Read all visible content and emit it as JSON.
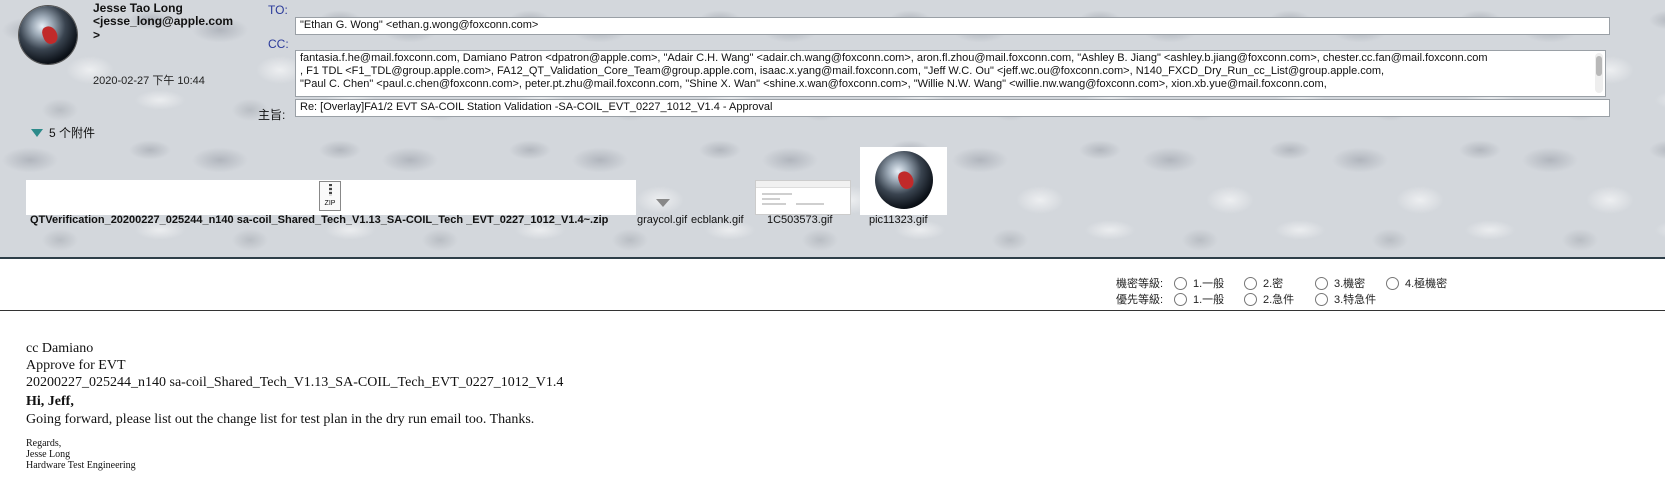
{
  "sender": {
    "name": "Jesse Tao Long",
    "email": "<jesse_long@apple.com",
    "email_end": ">",
    "date": "2020-02-27 下午 10:44"
  },
  "labels": {
    "to": "TO:",
    "cc": "CC:",
    "subject": "主旨:"
  },
  "to": "\"Ethan G. Wong\" <ethan.g.wong@foxconn.com>",
  "cc": [
    "fantasia.f.he@mail.foxconn.com, Damiano Patron <dpatron@apple.com>, \"Adair C.H. Wang\" <adair.ch.wang@foxconn.com>, aron.fl.zhou@mail.foxconn.com, \"Ashley B. Jiang\" <ashley.b.jiang@foxconn.com>, chester.cc.fan@mail.foxconn.com",
    ", F1 TDL <F1_TDL@group.apple.com>, FA12_QT_Validation_Core_Team@group.apple.com, isaac.x.yang@mail.foxconn.com, \"Jeff W.C. Ou\" <jeff.wc.ou@foxconn.com>, N140_FXCD_Dry_Run_cc_List@group.apple.com,",
    "\"Paul C. Chen\" <paul.c.chen@foxconn.com>, peter.pt.zhu@mail.foxconn.com, \"Shine X. Wan\" <shine.x.wan@foxconn.com>, \"Willie N.W. Wang\" <willie.nw.wang@foxconn.com>, xion.xb.yue@mail.foxconn.com,"
  ],
  "subject": "Re: [Overlay]FA1/2 EVT SA-COIL Station Validation -SA-COIL_EVT_0227_1012_V1.4 - Approval",
  "attachments": {
    "toggle_label": "5 个附件",
    "items": [
      {
        "name": "QTVerification_20200227_025244_n140 sa-coil_Shared_Tech_V1.13_SA-COIL_Tech _EVT_0227_1012_V1.4~.zip",
        "icon": "zip-icon",
        "icon_text": "ZIP"
      },
      {
        "name": "graycol.gif",
        "icon": "dropdown-arrow-icon"
      },
      {
        "name": "ecblank.gif",
        "icon": "blank-icon"
      },
      {
        "name": "1C503573.gif",
        "icon": "screenshot-thumbnail"
      },
      {
        "name": "pic11323.gif",
        "icon": "globe-thumbnail"
      }
    ]
  },
  "security": {
    "confidentiality_label": "機密等級:",
    "confidentiality_options": [
      "1.一般",
      "2.密",
      "3.機密",
      "4.極機密"
    ],
    "priority_label": "優先等級:",
    "priority_options": [
      "1.一般",
      "2.急件",
      "3.特急件"
    ]
  },
  "body": {
    "line1": "cc Damiano",
    "line2": "Approve for EVT",
    "line3": "20200227_025244_n140 sa-coil_Shared_Tech_V1.13_SA-COIL_Tech_EVT_0227_1012_V1.4",
    "greeting": "Hi, Jeff,",
    "message": "Going forward, please list out the change list for test plan in the dry run email too. Thanks.",
    "sig_regards": "Regards,",
    "sig_name": "Jesse Long",
    "sig_logo": "",
    "sig_dept": "Hardware Test Engineering"
  }
}
